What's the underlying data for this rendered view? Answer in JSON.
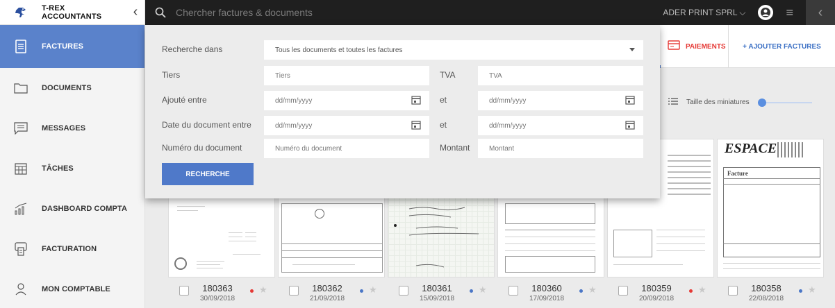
{
  "sidebar": {
    "brand": "T-REX ACCOUNTANTS",
    "collapse": "‹",
    "items": [
      {
        "label": "FACTURES",
        "icon": "invoice-icon"
      },
      {
        "label": "DOCUMENTS",
        "icon": "folder-icon"
      },
      {
        "label": "MESSAGES",
        "icon": "message-icon"
      },
      {
        "label": "TÂCHES",
        "icon": "tasks-calendar-icon"
      },
      {
        "label": "DASHBOARD COMPTA",
        "icon": "bar-chart-icon"
      },
      {
        "label": "FACTURATION",
        "icon": "billing-icon"
      },
      {
        "label": "MON COMPTABLE",
        "icon": "user-icon"
      }
    ]
  },
  "topbar": {
    "search_placeholder": "Chercher factures & documents",
    "company": "ADER PRINT SPRL ⌵",
    "menu": "≡",
    "collapse": "‹"
  },
  "tabs": {
    "payments": "PAIEMENTS",
    "add_invoices": "+ AJOUTER FACTURES"
  },
  "thumbnails": {
    "label": "Taille des miniatures",
    "size_fraction": 0.0
  },
  "search_panel": {
    "search_in_label": "Recherche dans",
    "search_in_value": "Tous les documents et toutes les factures",
    "tiers_label": "Tiers",
    "tiers_placeholder": "Tiers",
    "tva_label": "TVA",
    "tva_placeholder": "TVA",
    "added_between_label": "Ajouté entre",
    "date_placeholder": "dd/mm/yyyy",
    "and_label": "et",
    "doc_date_label": "Date du document entre",
    "doc_number_label": "Numéro du document",
    "doc_number_placeholder": "Numéro du document",
    "amount_label": "Montant",
    "amount_placeholder": "Montant",
    "search_button": "RECHERCHE"
  },
  "documents": [
    {
      "number": "180363",
      "date": "30/09/2018",
      "dot_color": "#e53935"
    },
    {
      "number": "180362",
      "date": "21/09/2018",
      "dot_color": "#4a76c6"
    },
    {
      "number": "180361",
      "date": "15/09/2018",
      "dot_color": "#4a76c6"
    },
    {
      "number": "180360",
      "date": "17/09/2018",
      "dot_color": "#4a76c6"
    },
    {
      "number": "180359",
      "date": "20/09/2018",
      "dot_color": "#e53935"
    },
    {
      "number": "180358",
      "date": "22/08/2018",
      "dot_color": "#4a76c6"
    }
  ],
  "thumb_text": {
    "espace_logo": "ESPACE",
    "facture_word": "Facture"
  },
  "colors": {
    "accent": "#5a82cb",
    "topbar": "#1f1f1f",
    "payments": "#e53935"
  }
}
